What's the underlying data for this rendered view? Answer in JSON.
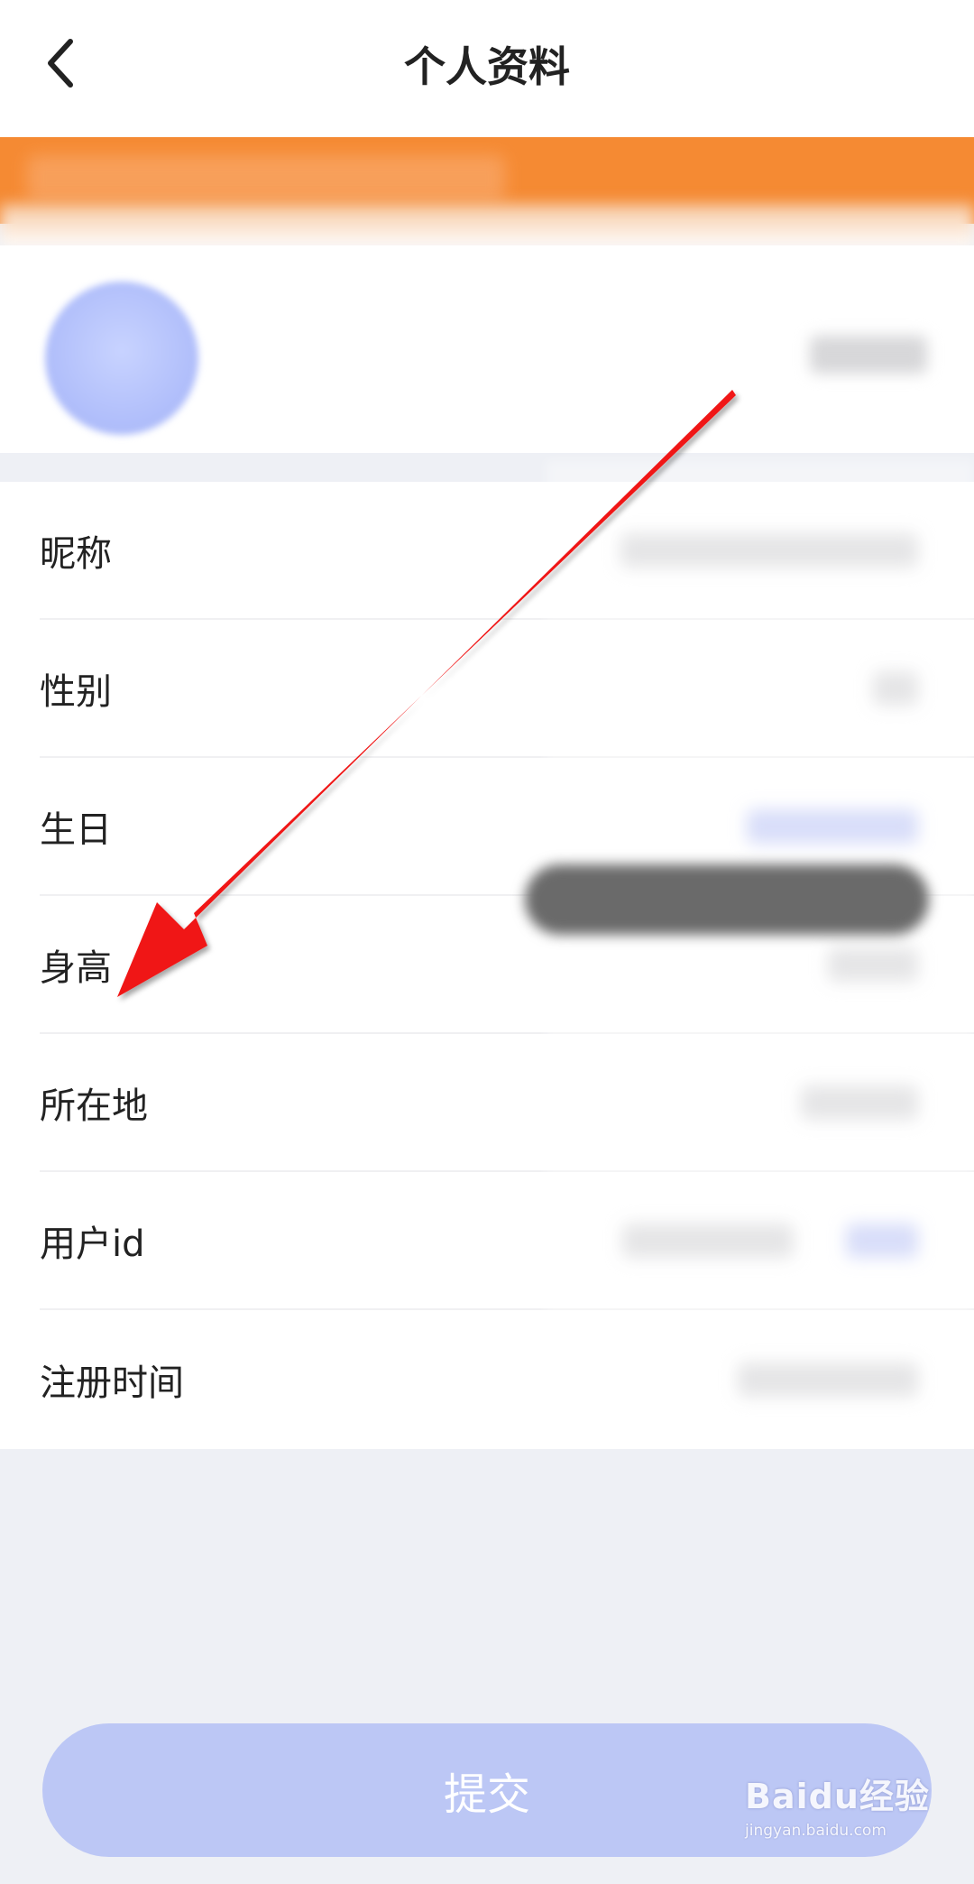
{
  "header": {
    "title": "个人资料"
  },
  "profile_rows": [
    {
      "label": "昵称"
    },
    {
      "label": "性别"
    },
    {
      "label": "生日"
    },
    {
      "label": "身高"
    },
    {
      "label": "所在地"
    },
    {
      "label": "用户id"
    },
    {
      "label": "注册时间"
    }
  ],
  "actions": {
    "submit_label": "提交"
  },
  "colors": {
    "notice_bar": "#f58a33",
    "submit_button": "#bcc7f5",
    "annotation_arrow": "#f01818",
    "page_background": "#eef0f5"
  },
  "icons": {
    "back": "chevron-left-icon"
  },
  "watermark": {
    "brand": "Baidu经验",
    "url": "jingyan.baidu.com"
  }
}
